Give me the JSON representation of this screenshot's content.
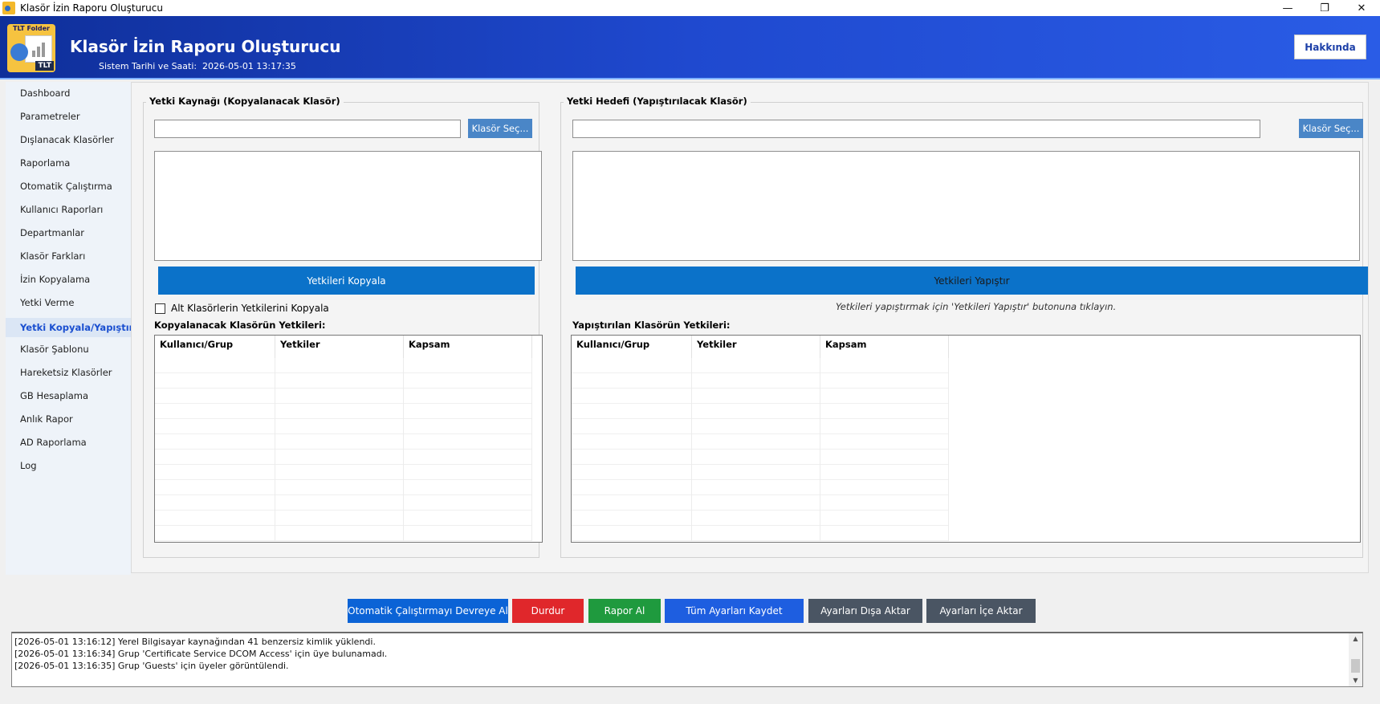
{
  "window": {
    "title": "Klasör İzin Raporu Oluşturucu",
    "controls": {
      "minimize": "—",
      "maximize": "❐",
      "close": "✕"
    }
  },
  "header": {
    "logo_text": "TLT Folder",
    "logo_badge": "TLT",
    "title": "Klasör İzin Raporu Oluşturucu",
    "sys_label": "Sistem Tarihi ve Saati:",
    "sys_value": "2026-05-01 13:17:35",
    "about_label": "Hakkında"
  },
  "sidebar": {
    "items": [
      {
        "label": "Dashboard"
      },
      {
        "label": "Parametreler"
      },
      {
        "label": "Dışlanacak Klasörler"
      },
      {
        "label": "Raporlama"
      },
      {
        "label": "Otomatik Çalıştırma"
      },
      {
        "label": "Kullanıcı Raporları"
      },
      {
        "label": "Departmanlar"
      },
      {
        "label": "Klasör Farkları"
      },
      {
        "label": "İzin Kopyalama"
      },
      {
        "label": "Yetki Verme"
      },
      {
        "label": "Yetki Kopyala/Yapıştır"
      },
      {
        "label": "Klasör Şablonu"
      },
      {
        "label": "Hareketsiz Klasörler"
      },
      {
        "label": "GB Hesaplama"
      },
      {
        "label": "Anlık Rapor"
      },
      {
        "label": "AD Raporlama"
      },
      {
        "label": "Log"
      }
    ]
  },
  "source": {
    "group_title": "Yetki Kaynağı (Kopyalanacak Klasör)",
    "path_value": "",
    "browse_label": "Klasör Seç...",
    "copy_label": "Yetkileri Kopyala",
    "subfolders_label": "Alt Klasörlerin Yetkilerini Kopyala",
    "grid_label": "Kopyalanacak Klasörün Yetkileri:",
    "columns": [
      "Kullanıcı/Grup",
      "Yetkiler",
      "Kapsam"
    ]
  },
  "target": {
    "group_title": "Yetki Hedefi (Yapıştırılacak Klasör)",
    "path_value": "",
    "browse_label": "Klasör Seç...",
    "paste_label": "Yetkileri Yapıştır",
    "hint": "Yetkileri yapıştırmak için 'Yetkileri Yapıştır' butonuna tıklayın.",
    "grid_label": "Yapıştırılan Klasörün Yetkileri:",
    "columns": [
      "Kullanıcı/Grup",
      "Yetkiler",
      "Kapsam"
    ]
  },
  "actions": {
    "auto_run": "Otomatik Çalıştırmayı Devreye Al",
    "stop": "Durdur",
    "report": "Rapor Al",
    "save_all": "Tüm Ayarları Kaydet",
    "export": "Ayarları Dışa Aktar",
    "import": "Ayarları İçe Aktar"
  },
  "colors": {
    "auto_run": "#0b63d6",
    "stop": "#e0272b",
    "report": "#1f9a3e",
    "save_all": "#1e5ee0",
    "export": "#4a5563",
    "import": "#4a5563"
  },
  "log": {
    "lines": [
      "[2026-05-01 13:16:12] Yerel Bilgisayar kaynağından 41 benzersiz kimlik yüklendi.",
      "[2026-05-01 13:16:34] Grup 'Certificate Service DCOM Access' için üye bulunamadı.",
      "[2026-05-01 13:16:35] Grup 'Guests' için üyeler görüntülendi."
    ]
  }
}
